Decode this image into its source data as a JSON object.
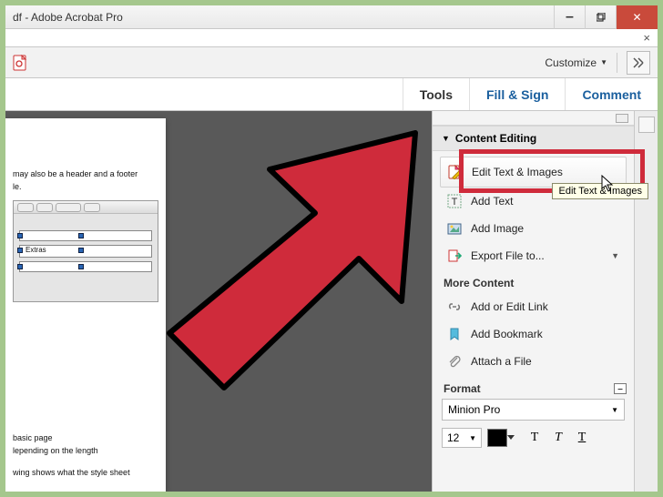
{
  "window": {
    "title": "df - Adobe Acrobat Pro"
  },
  "toolbar": {
    "customize_label": "Customize"
  },
  "tabs": {
    "tools": "Tools",
    "fill_sign": "Fill & Sign",
    "comment": "Comment"
  },
  "sidepanel": {
    "section_title": "Content Editing",
    "items": {
      "edit_text_images": "Edit Text & Images",
      "add_text": "Add Text",
      "add_image": "Add Image",
      "export_file": "Export File to..."
    },
    "more_content_label": "More Content",
    "more_items": {
      "add_edit_link": "Add or Edit Link",
      "add_bookmark": "Add Bookmark",
      "attach_file": "Attach a File"
    },
    "format_label": "Format",
    "font_name": "Minion Pro",
    "font_size": "12"
  },
  "tooltip": {
    "text": "Edit Text & Images"
  },
  "document": {
    "line1": "may also be a header and a footer",
    "line2": "le.",
    "line3": "basic page",
    "line4": "lepending on the length",
    "line5": "wing shows what the style sheet",
    "mini_row_label": "Extras"
  }
}
